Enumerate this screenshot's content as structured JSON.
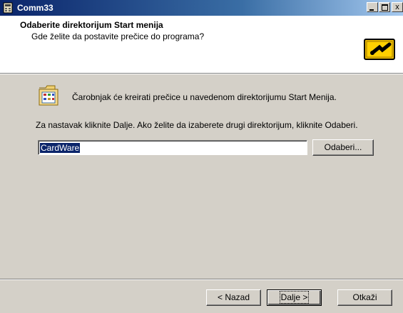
{
  "window": {
    "title": "Comm33"
  },
  "titlebar": {
    "min": "_",
    "max": "",
    "close": "x"
  },
  "header": {
    "title": "Odaberite direktorijum Start menija",
    "subtitle": "Gde želite da postavite prečice do programa?"
  },
  "body": {
    "info": "Čarobnjak će kreirati prečice u navedenom direktorijumu Start Menija.",
    "instruction": "Za nastavak kliknite Dalje. Ako želite da izaberete drugi direktorijum, kliknite Odaberi."
  },
  "directory": {
    "value": "CardWare"
  },
  "buttons": {
    "browse": "Odaberi...",
    "back": "< Nazad",
    "next": "Dalje >",
    "cancel": "Otkaži"
  },
  "icons": {
    "app": "app-icon",
    "wizard": "wizard-key-icon",
    "folder": "program-folder-icon"
  },
  "colors": {
    "titlebar_start": "#0a246a",
    "titlebar_end": "#a6caf0",
    "face": "#d4d0c8",
    "selection": "#0a246a"
  }
}
